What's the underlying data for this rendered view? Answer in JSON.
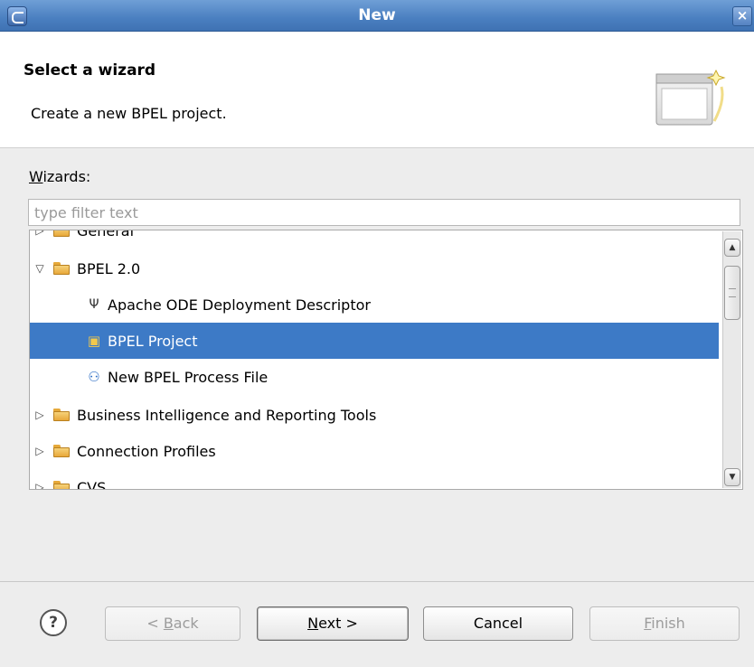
{
  "window": {
    "title": "New",
    "close_glyph": "×"
  },
  "header": {
    "title": "Select a wizard",
    "description": "Create a new BPEL project."
  },
  "wizards": {
    "label_mnemonic": "W",
    "label_rest": "izards:",
    "filter_placeholder": "type filter text",
    "filter_value": ""
  },
  "tree": {
    "items": [
      {
        "label": "General",
        "indent": 0,
        "toggle": "▷",
        "icon": "folder-icon",
        "partial": true
      },
      {
        "label": "BPEL 2.0",
        "indent": 0,
        "toggle": "▽",
        "icon": "folder-icon"
      },
      {
        "label": "Apache ODE Deployment Descriptor",
        "indent": 1,
        "toggle": "",
        "icon": "deployment-descriptor-icon"
      },
      {
        "label": "BPEL Project",
        "indent": 1,
        "toggle": "",
        "icon": "bpel-project-icon",
        "selected": true
      },
      {
        "label": "New BPEL Process File",
        "indent": 1,
        "toggle": "",
        "icon": "bpel-process-file-icon"
      },
      {
        "label": "Business Intelligence and Reporting Tools",
        "indent": 0,
        "toggle": "▷",
        "icon": "folder-icon"
      },
      {
        "label": "Connection Profiles",
        "indent": 0,
        "toggle": "▷",
        "icon": "folder-icon"
      },
      {
        "label": "CVS",
        "indent": 0,
        "toggle": "▷",
        "icon": "folder-icon",
        "partial": true
      }
    ]
  },
  "buttons": {
    "help": "?",
    "back": {
      "pre": "< ",
      "mn": "B",
      "post": "ack"
    },
    "next": {
      "pre": "",
      "mn": "N",
      "post": "ext >"
    },
    "cancel": "Cancel",
    "finish": {
      "pre": "",
      "mn": "F",
      "post": "inish"
    }
  },
  "colors": {
    "selection": "#3d7ac6",
    "titlebar": "#4a7fc0"
  }
}
